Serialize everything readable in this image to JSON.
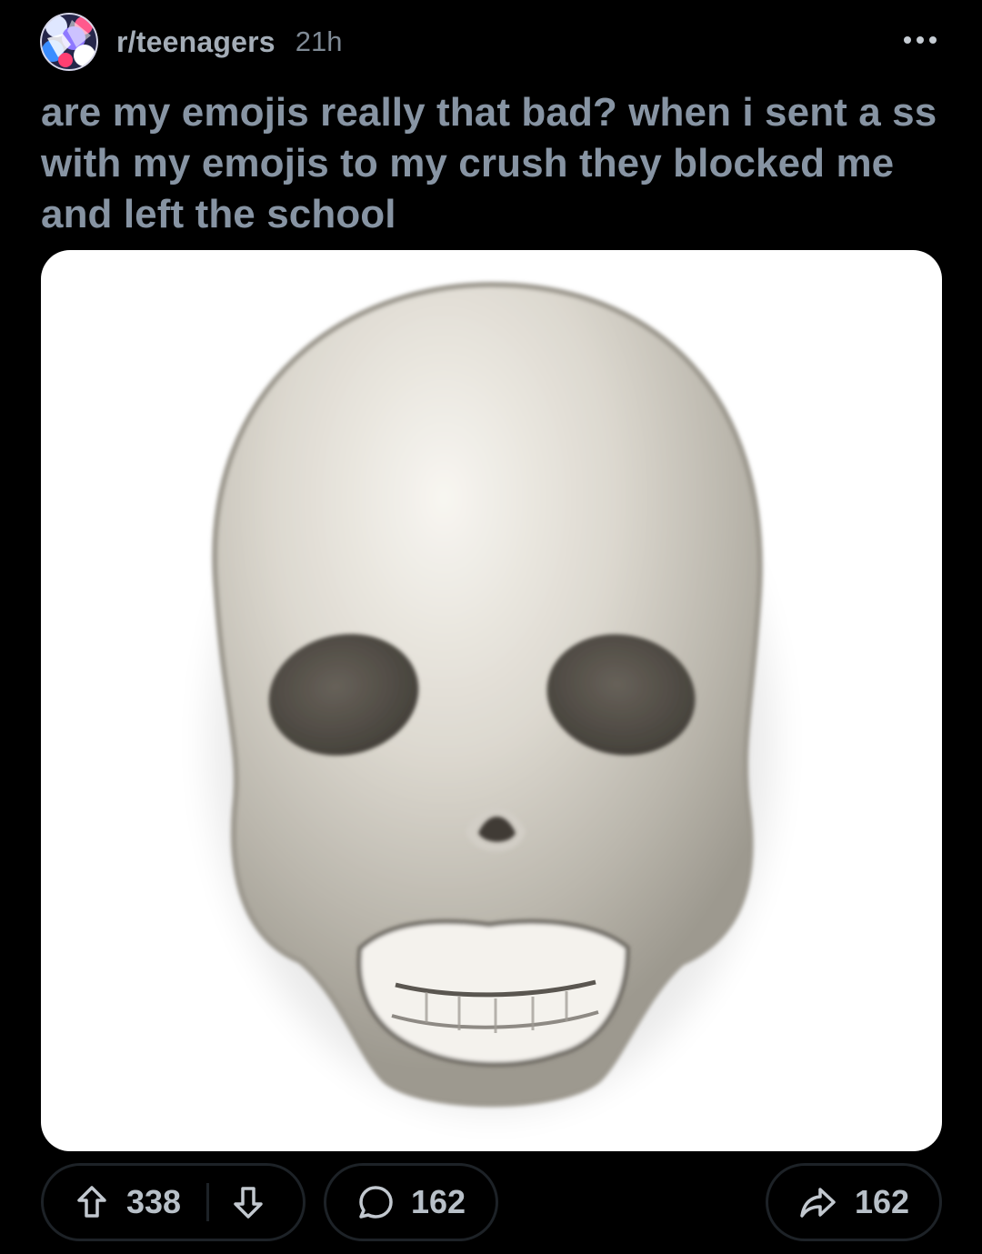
{
  "post": {
    "subreddit": "r/teenagers",
    "age": "21h",
    "title": "are my emojis really that bad? when i sent a ss with my emojis to my crush they blocked me and left the school",
    "image_subject": "skull-emoji"
  },
  "actions": {
    "upvotes": "338",
    "comments": "162",
    "shares": "162"
  },
  "icons": {
    "more": "more-icon",
    "upvote": "upvote-arrow-icon",
    "downvote": "downvote-arrow-icon",
    "comment": "comment-bubble-icon",
    "share": "share-arrow-icon"
  },
  "colors": {
    "background": "#000000",
    "title_text": "#8794a3",
    "meta_text": "#a4adb7",
    "pill_border": "#1d2227",
    "pill_text": "#b8c0c8"
  }
}
